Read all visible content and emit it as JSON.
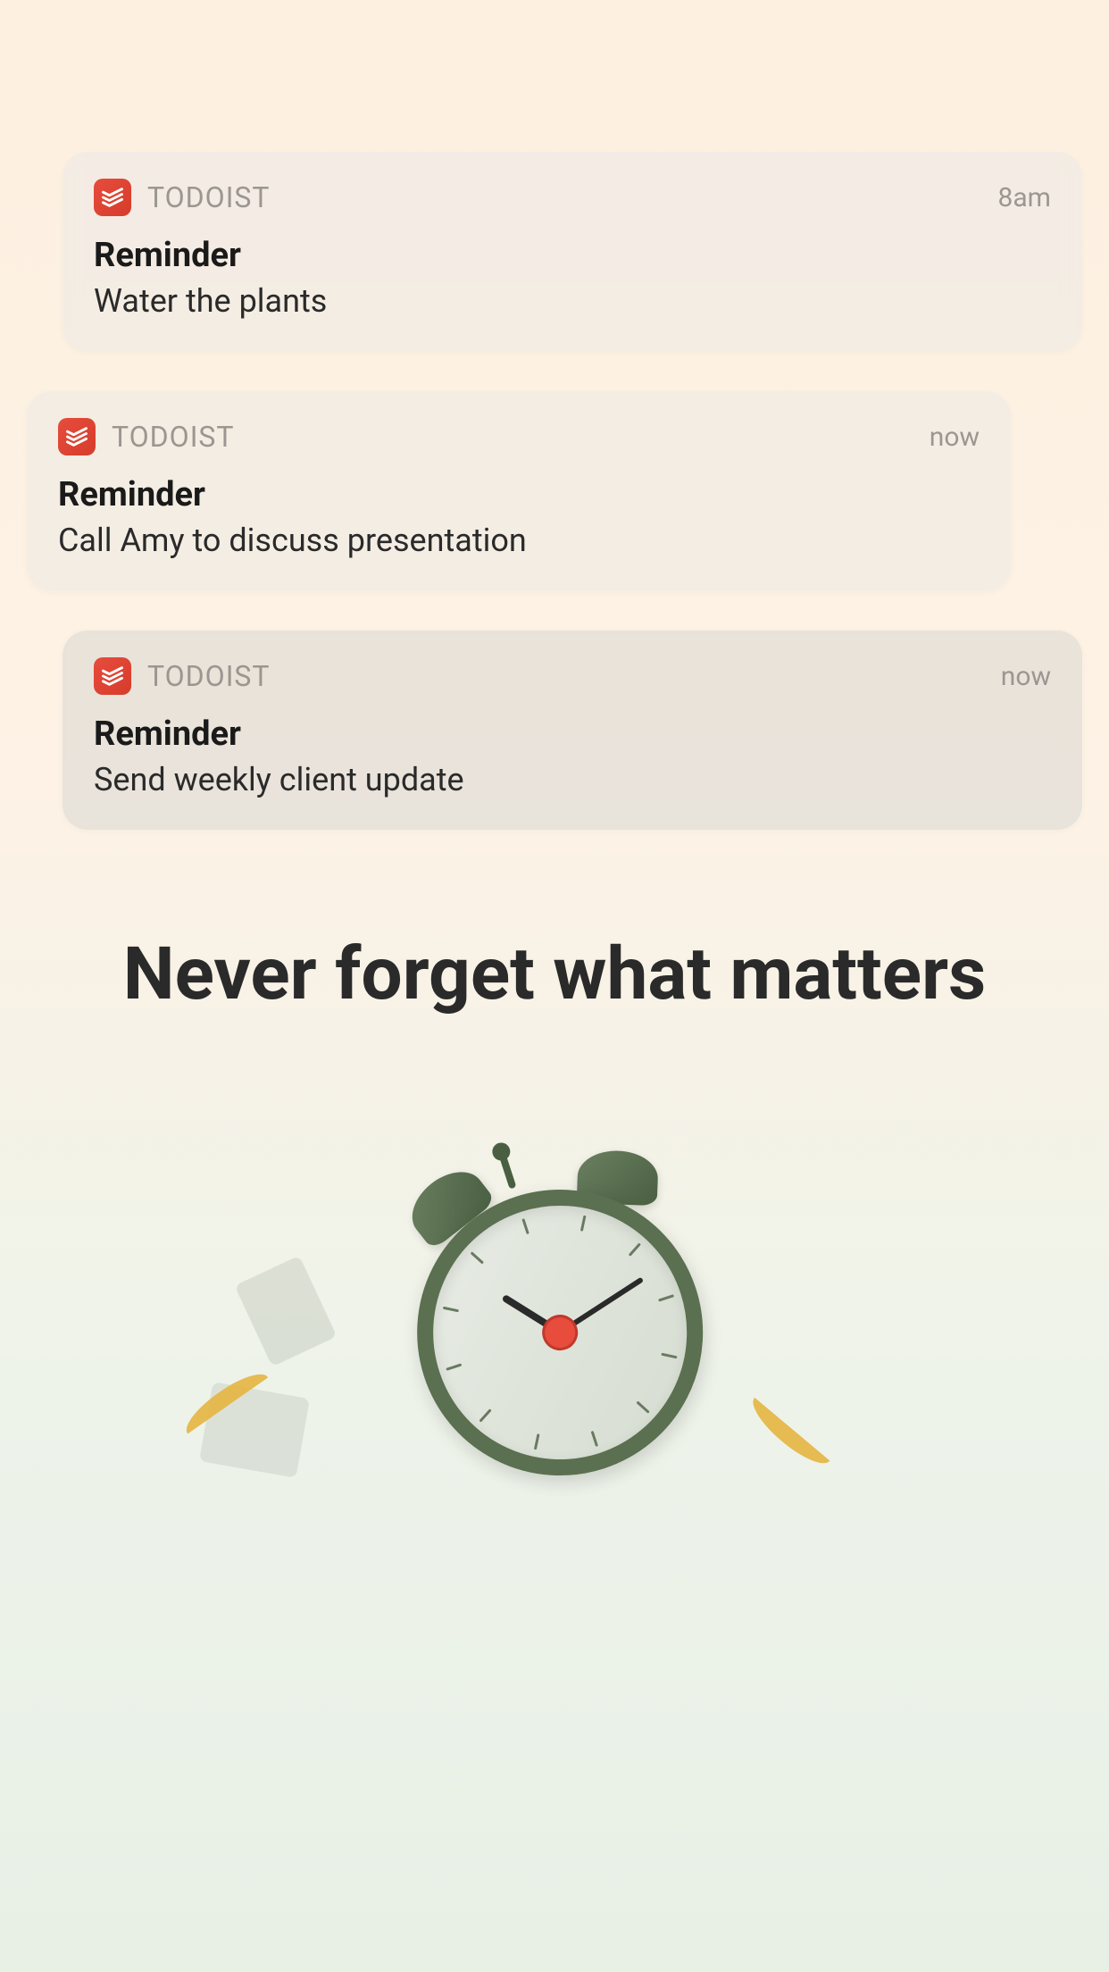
{
  "notifications": [
    {
      "app_name": "TODOIST",
      "time": "8am",
      "title": "Reminder",
      "body": "Water the plants"
    },
    {
      "app_name": "TODOIST",
      "time": "now",
      "title": "Reminder",
      "body": "Call Amy to discuss presentation"
    },
    {
      "app_name": "TODOIST",
      "time": "now",
      "title": "Reminder",
      "body": "Send weekly client update"
    }
  ],
  "headline": "Never forget what matters"
}
